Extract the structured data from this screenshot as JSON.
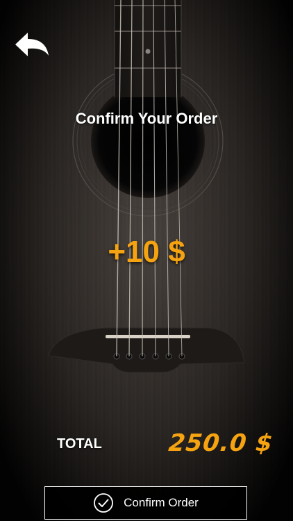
{
  "header": {
    "back_icon": "back-arrow-icon"
  },
  "title": "Confirm Your Order",
  "amount_delta": "+10 $",
  "total": {
    "label": "TOTAL",
    "value": "250.0 $"
  },
  "confirm_button": {
    "label": "Confirm Order",
    "icon": "check-circle-icon"
  },
  "colors": {
    "accent": "#f5a310",
    "text": "#ffffff",
    "button_bg": "#000000"
  }
}
